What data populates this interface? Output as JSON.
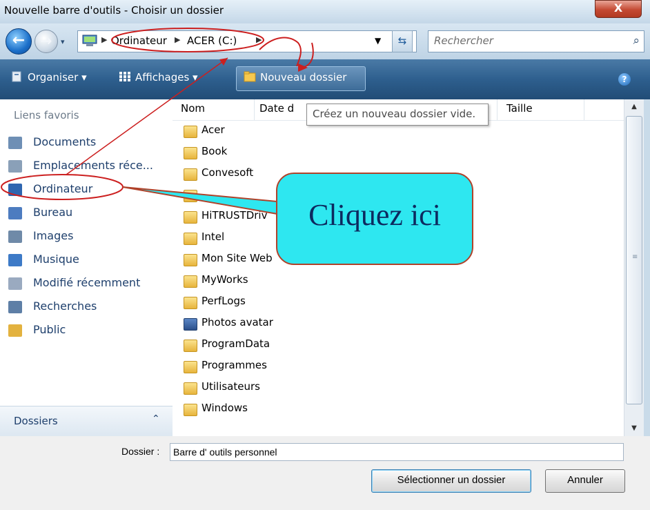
{
  "window": {
    "title": "Nouvelle barre d'outils - Choisir un dossier",
    "close_label": "X"
  },
  "nav": {
    "back_icon": "back-arrow-icon",
    "forward_icon": "forward-arrow-icon",
    "history_dropdown": "▾",
    "breadcrumb": [
      "Ordinateur",
      "ACER (C:)"
    ],
    "breadcrumb_sep": "▶",
    "address_dropdown": "▼",
    "refresh_icon": "⇆",
    "search_placeholder": "Rechercher",
    "search_icon": "⌕"
  },
  "toolbar": {
    "organize_label": "Organiser ▾",
    "views_label": "Affichages ▾",
    "new_folder_label": "Nouveau dossier",
    "help_label": "?"
  },
  "favorites": {
    "title": "Liens favoris",
    "items": [
      {
        "label": "Documents",
        "color": "#6e8fb5"
      },
      {
        "label": "Emplacements réce...",
        "color": "#8aa0b8"
      },
      {
        "label": "Ordinateur",
        "color": "#2f66b0"
      },
      {
        "label": "Bureau",
        "color": "#4d7cc0"
      },
      {
        "label": "Images",
        "color": "#6f8aa8"
      },
      {
        "label": "Musique",
        "color": "#3d7ac7"
      },
      {
        "label": "Modifié récemment",
        "color": "#9aaac0"
      },
      {
        "label": "Recherches",
        "color": "#5e7fa6"
      },
      {
        "label": "Public",
        "color": "#e3b23f"
      }
    ],
    "folders_label": "Dossiers",
    "folders_chevron": "⌃"
  },
  "list": {
    "columns": [
      "Nom",
      "Date d",
      "Taille"
    ],
    "sort_indicator": "⌃",
    "files": [
      "Acer",
      "Book",
      "Convesoft",
      "",
      "HiTRUSTDriv",
      "Intel",
      "Mon Site Web",
      "MyWorks",
      "PerfLogs",
      "Photos avatar",
      "ProgramData",
      "Programmes",
      "Utilisateurs",
      "Windows"
    ],
    "special_file": "Photos avatar"
  },
  "tooltip": {
    "text": "Créez un nouveau dossier vide."
  },
  "annotation": {
    "callout_text": "Cliquez ici",
    "accent_color": "#cc1f1f",
    "callout_fill": "#2ee7f0"
  },
  "scrollbar": {
    "up": "▲",
    "down": "▼",
    "grip": "≡"
  },
  "footer": {
    "folder_label": "Dossier :",
    "folder_value": "Barre d' outils personnel",
    "select_button": "Sélectionner un dossier",
    "cancel_button": "Annuler"
  }
}
